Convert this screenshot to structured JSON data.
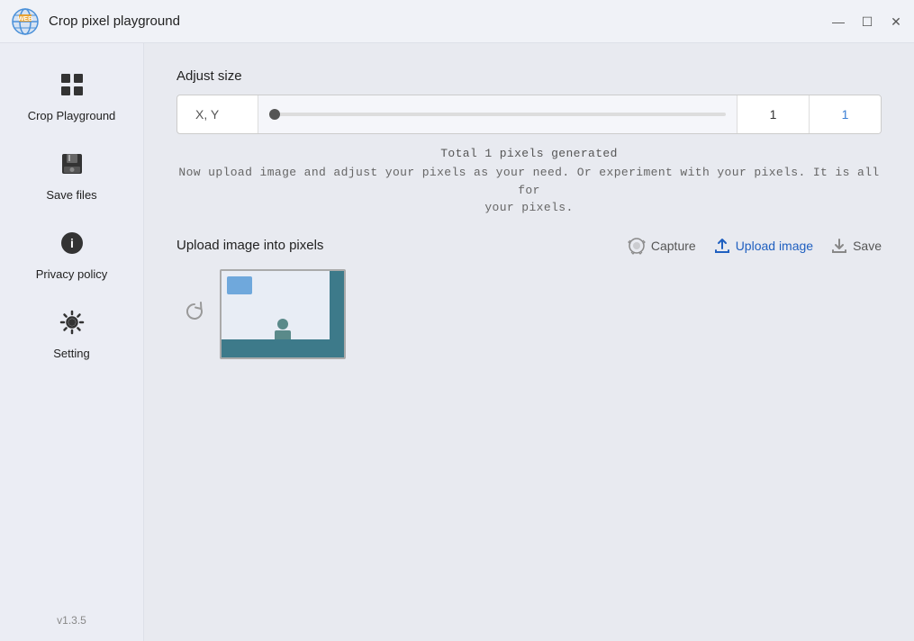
{
  "titleBar": {
    "appName": "Crop pixel playground",
    "minimizeBtn": "—",
    "maximizeBtn": "☐",
    "closeBtn": "✕"
  },
  "sidebar": {
    "items": [
      {
        "id": "crop-playground",
        "label": "Crop Playground",
        "icon": "⊞"
      },
      {
        "id": "save-files",
        "label": "Save files",
        "icon": "💾"
      },
      {
        "id": "privacy-policy",
        "label": "Privacy policy",
        "icon": "ℹ"
      },
      {
        "id": "setting",
        "label": "Setting",
        "icon": "⚙"
      }
    ],
    "version": "v1.3.5"
  },
  "adjustSize": {
    "label": "Adjust size",
    "xyLabel": "X, Y",
    "inputXValue": "1",
    "inputYValue": "1"
  },
  "infoText": {
    "pixelsGenerated": "Total 1 pixels generated",
    "instruction": "Now upload image and adjust your pixels as your need. Or experiment with your pixels. It is all for\nyour pixels."
  },
  "uploadSection": {
    "title": "Upload image into pixels",
    "captureLabel": "Capture",
    "uploadLabel": "Upload image",
    "saveLabel": "Save"
  }
}
